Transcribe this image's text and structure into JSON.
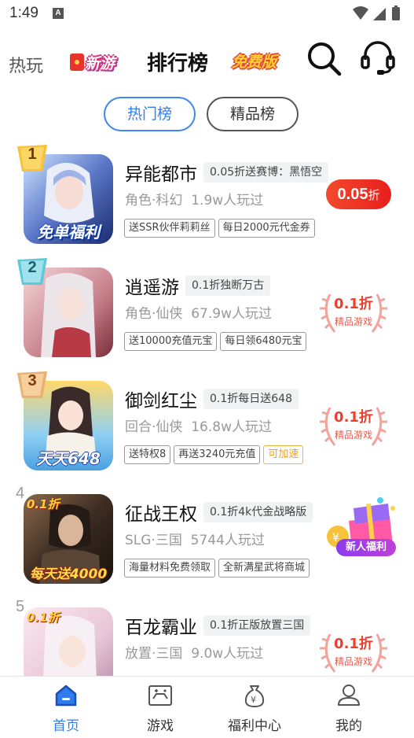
{
  "status_bar": {
    "time": "1:49",
    "notification_icon": "a-box-icon"
  },
  "top_nav": {
    "hot": "热玩",
    "new_games": "新游",
    "ranking": "排行榜",
    "free": "免费版"
  },
  "tabs": [
    {
      "label": "热门榜",
      "active": true
    },
    {
      "label": "精品榜",
      "active": false
    }
  ],
  "games": [
    {
      "rank": "1",
      "title": "异能都市",
      "promo": "0.05折送赛博：黑悟空",
      "category": "角色·科幻",
      "players": "1.9w人玩过",
      "tags": [
        "送SSR伙伴莉莉丝",
        "每日2000元代金券"
      ],
      "cover_caption": "免单福利",
      "discount_value": "0.05",
      "discount_unit": "折"
    },
    {
      "rank": "2",
      "title": "逍遥游",
      "promo": "0.1折独断万古",
      "category": "角色·仙侠",
      "players": "67.9w人玩过",
      "tags": [
        "送10000充值元宝",
        "每日领6480元宝"
      ],
      "stamp_value": "0.1折",
      "stamp_label": "精品游戏"
    },
    {
      "rank": "3",
      "title": "御剑红尘",
      "promo": "0.1折每日送648",
      "category": "回合·仙侠",
      "players": "16.8w人玩过",
      "tags": [
        "送特权8",
        "再送3240元充值"
      ],
      "speed_tag": "可加速",
      "cover_caption": "天天648",
      "stamp_value": "0.1折",
      "stamp_label": "精品游戏"
    },
    {
      "rank": "4",
      "title": "征战王权",
      "promo": "0.1折4k代金战略版",
      "category": "SLG·三国",
      "players": "5744人玩过",
      "tags": [
        "海量材料免费领取",
        "全新满星武将商城"
      ],
      "cover_badge": "0.1折",
      "cover_caption": "每天送4000",
      "welfare_label": "新人福利"
    },
    {
      "rank": "5",
      "title": "百龙霸业",
      "promo": "0.1折正版放置三国",
      "category": "放置·三国",
      "players": "9.0w人玩过",
      "cover_badge": "0.1折",
      "stamp_value": "0.1折",
      "stamp_label": "精品游戏"
    }
  ],
  "bottom_nav": [
    {
      "label": "首页",
      "icon": "home-icon",
      "active": true
    },
    {
      "label": "游戏",
      "icon": "gamepad-icon",
      "active": false
    },
    {
      "label": "福利中心",
      "icon": "money-bag-icon",
      "active": false
    },
    {
      "label": "我的",
      "icon": "profile-icon",
      "active": false
    }
  ],
  "colors": {
    "accent": "#2f7cf0",
    "discount": "#e8322c",
    "speed": "#f0a020"
  }
}
